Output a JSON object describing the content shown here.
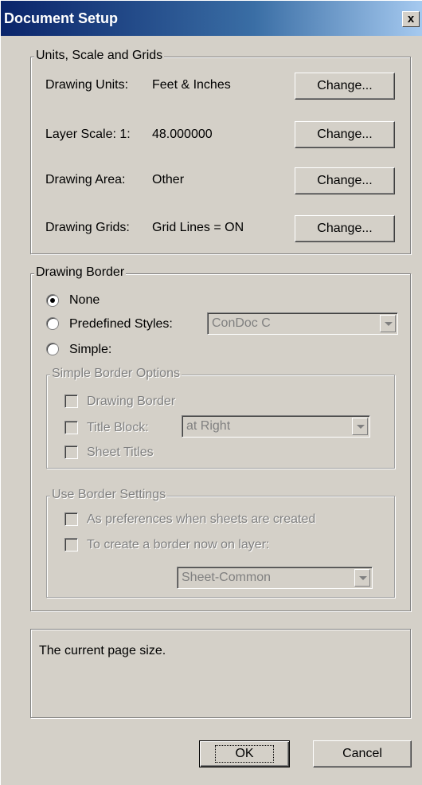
{
  "window": {
    "title": "Document Setup",
    "close_label": "x"
  },
  "units_group": {
    "legend": "Units, Scale and Grids",
    "rows": [
      {
        "label": "Drawing Units:",
        "value": "Feet & Inches",
        "button": "Change..."
      },
      {
        "label": "Layer Scale:  1:",
        "value": "48.000000",
        "button": "Change..."
      },
      {
        "label": "Drawing Area:",
        "value": "Other",
        "button": "Change..."
      },
      {
        "label": "Drawing Grids:",
        "value": "Grid Lines = ON",
        "button": "Change..."
      }
    ]
  },
  "border_group": {
    "legend": "Drawing Border",
    "options": [
      {
        "label": "None",
        "checked": true
      },
      {
        "label": "Predefined Styles:",
        "checked": false
      },
      {
        "label": "Simple:",
        "checked": false
      }
    ],
    "predefined_style": "ConDoc C",
    "simple_options": {
      "legend": "Simple Border Options",
      "drawing_border": "Drawing Border",
      "title_block": "Title Block:",
      "title_block_position": "at Right",
      "sheet_titles": "Sheet Titles"
    },
    "use_settings": {
      "legend": "Use Border Settings",
      "preferences": "As preferences when sheets are created",
      "create_now": "To create a border now on layer:",
      "layer": "Sheet-Common"
    }
  },
  "status": {
    "text": "The current page size."
  },
  "buttons": {
    "ok": "OK",
    "cancel": "Cancel"
  }
}
